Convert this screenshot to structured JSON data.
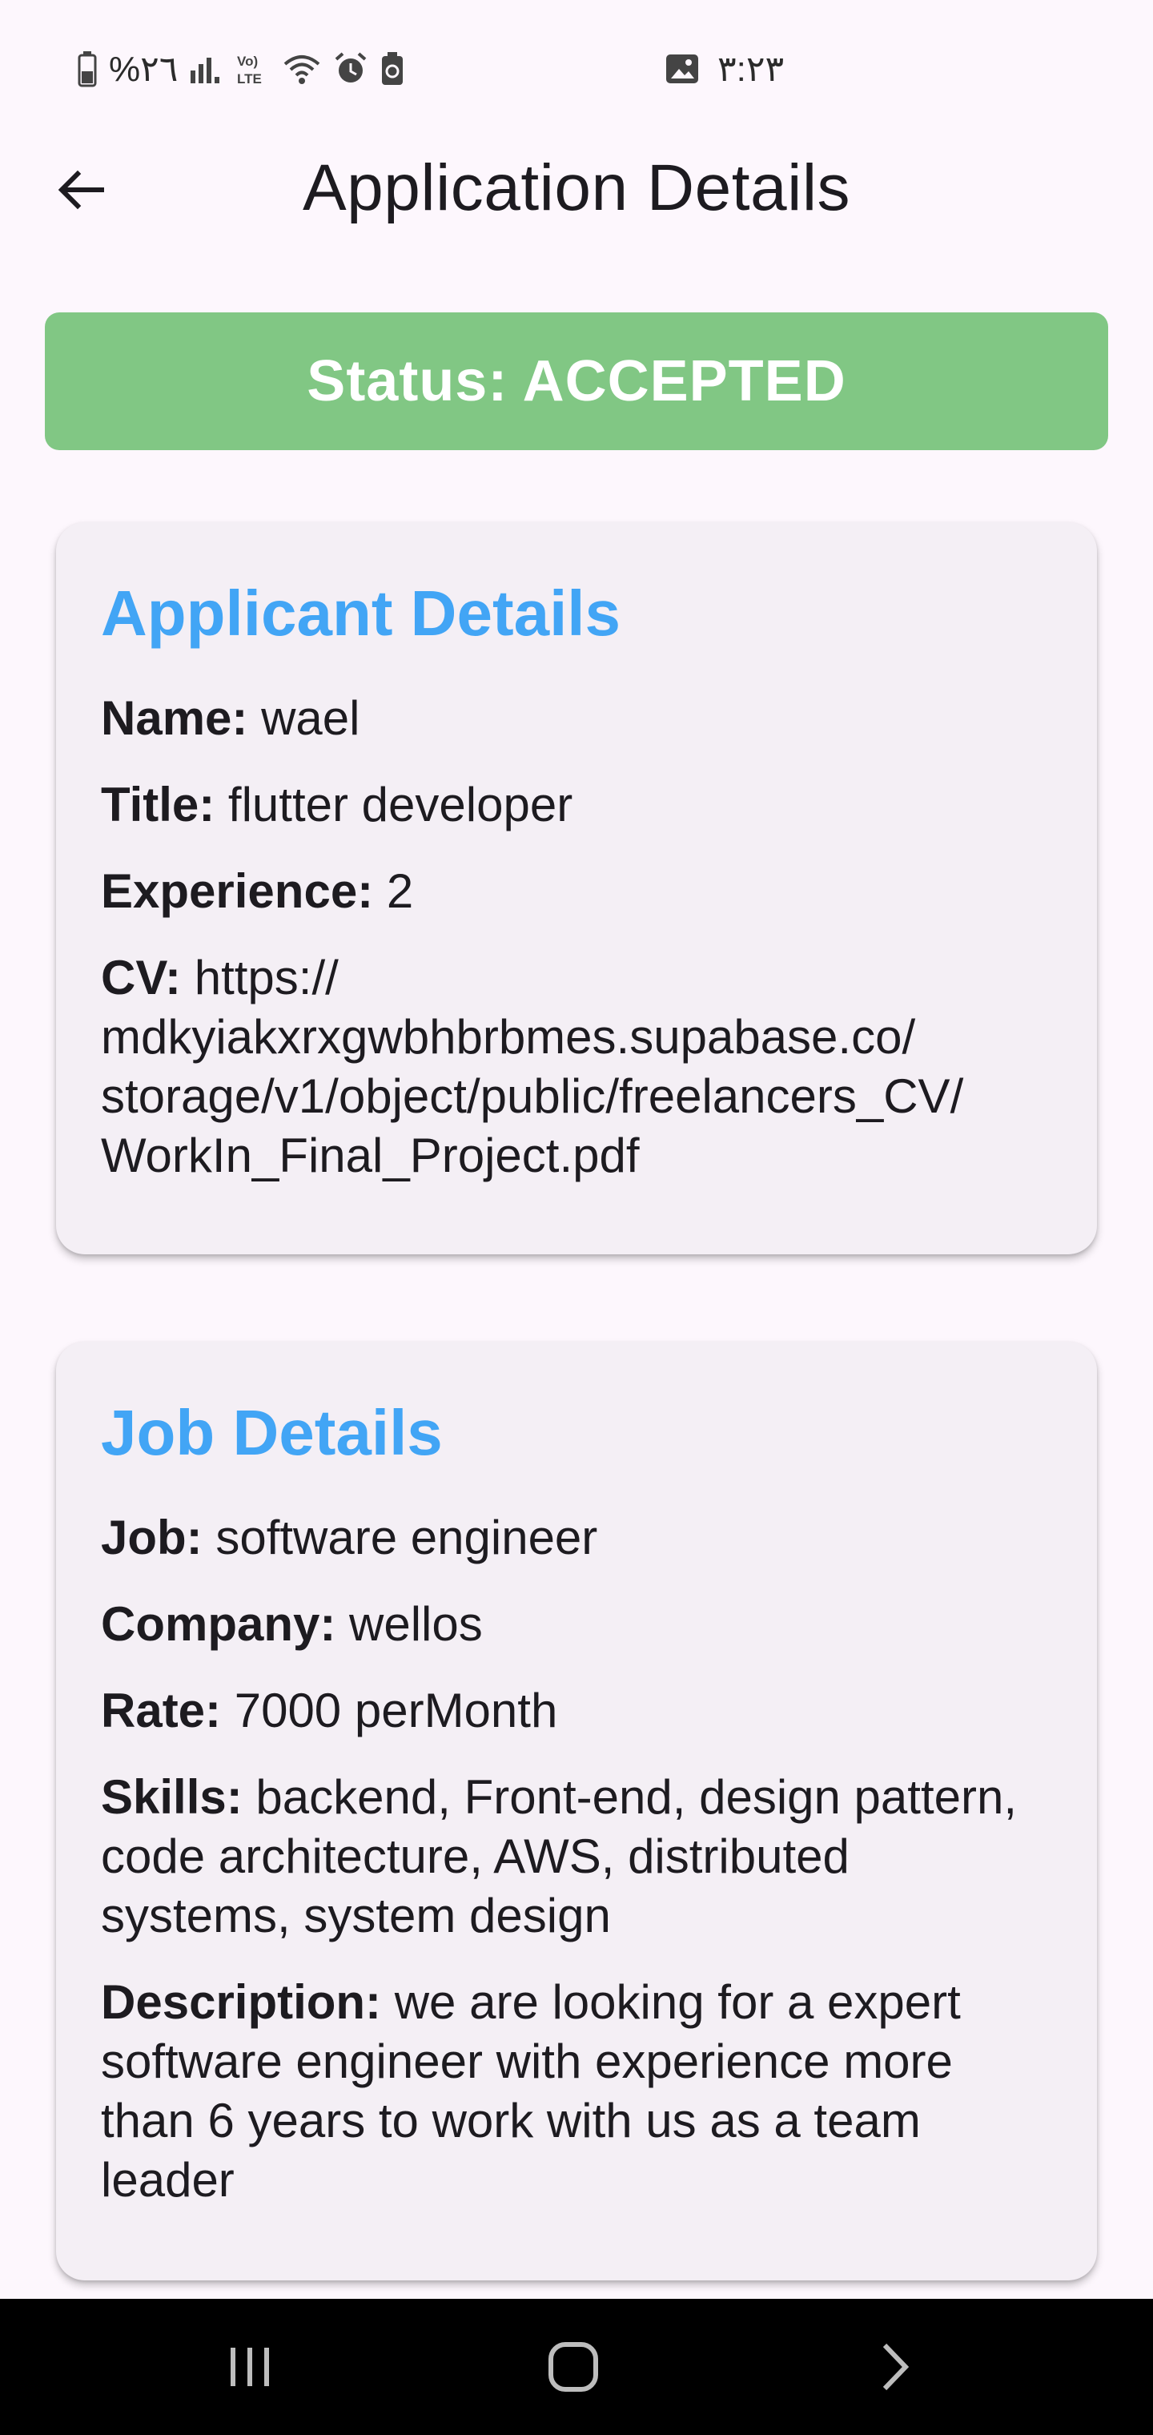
{
  "status_bar": {
    "battery_text": "%٢٦",
    "time": "٣:٢٣",
    "icons": [
      "battery-icon",
      "signal-icon",
      "volte-icon",
      "wifi-icon",
      "alarm-icon",
      "recycle-icon",
      "gallery-icon"
    ]
  },
  "app_bar": {
    "title": "Application Details",
    "back_icon": "arrow-back-icon"
  },
  "status_banner": {
    "text": "Status: ACCEPTED",
    "color": "#81c784"
  },
  "applicant": {
    "title": "Applicant Details",
    "rows": [
      {
        "label": "Name:",
        "value": "wael"
      },
      {
        "label": "Title:",
        "value": "flutter developer"
      },
      {
        "label": "Experience:",
        "value": "2"
      },
      {
        "label": "CV:",
        "value": "https:// mdkyiakxrxgwbhbrbmes.supabase.co/ storage/v1/object/public/freelancers_CV/ WorkIn_Final_Project.pdf"
      }
    ]
  },
  "job": {
    "title": "Job Details",
    "rows": [
      {
        "label": "Job:",
        "value": "software engineer"
      },
      {
        "label": "Company:",
        "value": "wellos"
      },
      {
        "label": "Rate:",
        "value": "7000 perMonth"
      },
      {
        "label": "Skills:",
        "value": "backend,  Front-end,  design pattern,  code architecture, AWS, distributed systems,  system design"
      },
      {
        "label": "Description:",
        "value": "we are looking for a expert software engineer with experience more than 6 years to work with us as a team leader"
      }
    ]
  },
  "colors": {
    "accent": "#42a5f5",
    "background": "#fdf7fd",
    "card": "#f4eff5"
  },
  "nav_bar": {
    "buttons": [
      "recent-apps-icon",
      "home-icon",
      "back-icon"
    ]
  }
}
